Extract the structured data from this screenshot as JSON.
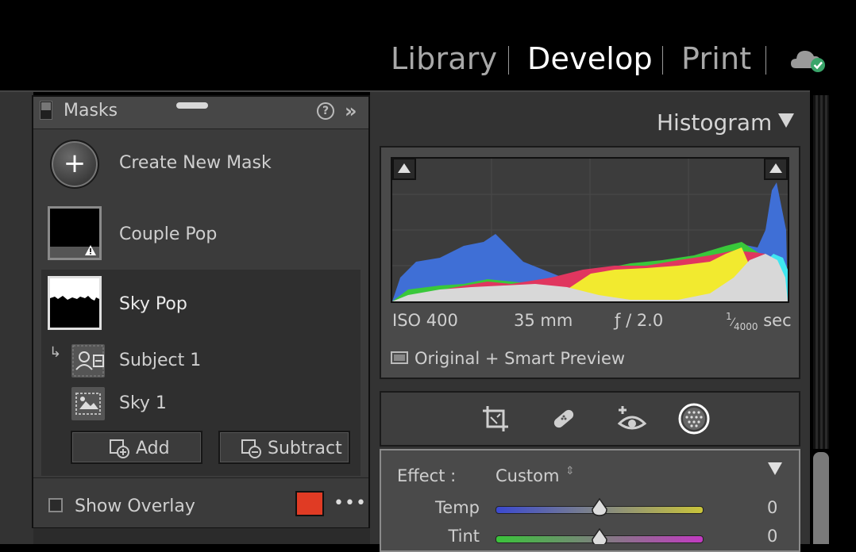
{
  "modules": {
    "library": "Library",
    "develop": "Develop",
    "print": "Print",
    "active": "develop"
  },
  "masks": {
    "title": "Masks",
    "help_icon": "?",
    "expand_icon": "»",
    "create_new": "Create New Mask",
    "items": [
      {
        "label": "Couple Pop",
        "selected": false
      },
      {
        "label": "Sky Pop",
        "selected": true
      }
    ],
    "components": [
      {
        "label": "Subject 1"
      },
      {
        "label": "Sky 1"
      }
    ],
    "add_label": "Add",
    "subtract_label": "Subtract",
    "show_overlay": "Show Overlay",
    "overlay_color": "#e03b24",
    "more_icon": "•••"
  },
  "histogram": {
    "title": "Histogram",
    "iso": "ISO 400",
    "focal": "35 mm",
    "aperture": "ƒ / 2.0",
    "shutter_num": "1",
    "shutter_den": "4000",
    "shutter_unit": "sec",
    "preview": "Original + Smart Preview"
  },
  "effect": {
    "label": "Effect :",
    "value": "Custom",
    "updown_icon": "⇕",
    "sliders": [
      {
        "label": "Temp",
        "value": "0"
      },
      {
        "label": "Tint",
        "value": "0"
      }
    ]
  },
  "colors": {
    "active_text": "#ffffff",
    "inactive_text": "#a8a8a8",
    "cloud_ok": "#3aa56a"
  }
}
